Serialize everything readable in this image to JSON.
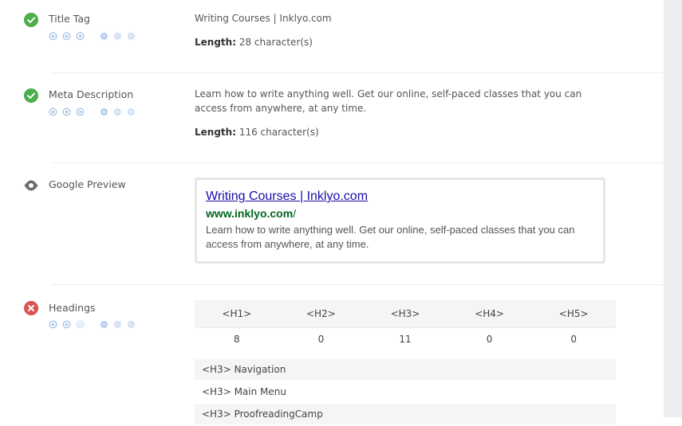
{
  "title_tag": {
    "label": "Title Tag",
    "status": "pass",
    "value": "Writing Courses | Inklyo.com",
    "length_label": "Length:",
    "length_value": "28 character(s)"
  },
  "meta_description": {
    "label": "Meta Description",
    "status": "pass",
    "value": "Learn how to write anything well. Get our online, self-paced classes that you can access from anywhere, at any time.",
    "length_label": "Length:",
    "length_value": "116 character(s)"
  },
  "google_preview": {
    "label": "Google Preview",
    "status": "info",
    "title": "Writing Courses | Inklyo.com",
    "url_bold": "www.inklyo.com",
    "url_rest": "/",
    "description": "Learn how to write anything well. Get our online, self-paced classes that you can access from anywhere, at any time."
  },
  "headings": {
    "label": "Headings",
    "status": "fail",
    "columns": [
      "<H1>",
      "<H2>",
      "<H3>",
      "<H4>",
      "<H5>"
    ],
    "counts": [
      "8",
      "0",
      "11",
      "0",
      "0"
    ],
    "items": [
      "<H3> Navigation",
      "<H3> Main Menu",
      "<H3> ProofreadingCamp"
    ]
  },
  "colors": {
    "pass": "#4cae4c",
    "info": "#6b6b6b",
    "fail": "#d9534f",
    "link": "#1a0dab",
    "url": "#006621",
    "mini_icon": "#a9c6e8"
  },
  "icons": {
    "pass": "check-circle-icon",
    "info": "eye-icon",
    "fail": "x-circle-icon",
    "importance": "target-icon",
    "difficulty": "gear-icon"
  }
}
